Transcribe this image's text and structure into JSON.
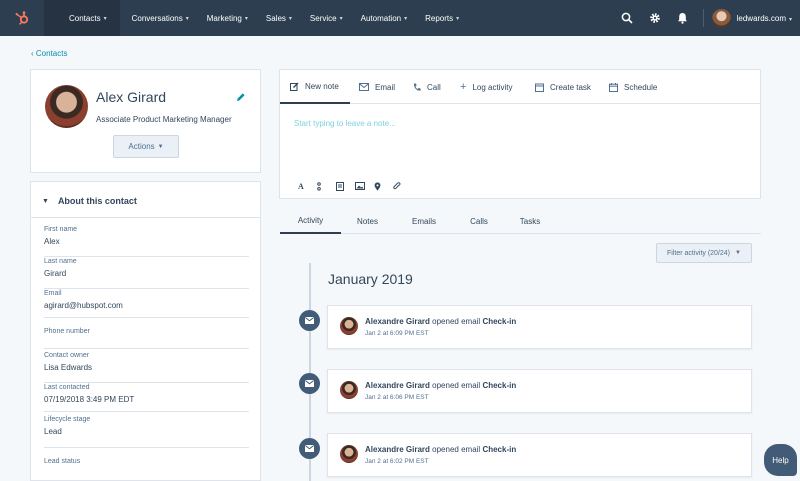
{
  "nav": {
    "items": [
      {
        "label": "Contacts",
        "active": true
      },
      {
        "label": "Conversations"
      },
      {
        "label": "Marketing"
      },
      {
        "label": "Sales"
      },
      {
        "label": "Service"
      },
      {
        "label": "Automation"
      },
      {
        "label": "Reports"
      }
    ],
    "account": "ledwards.com",
    "icons": [
      "search-icon",
      "gear-icon",
      "bell-icon"
    ]
  },
  "breadcrumb": "Contacts",
  "profile": {
    "name": "Alex Girard",
    "title": "Associate Product Marketing Manager",
    "actions_label": "Actions"
  },
  "about": {
    "header": "About this contact",
    "fields": [
      {
        "label": "First name",
        "value": "Alex"
      },
      {
        "label": "Last name",
        "value": "Girard"
      },
      {
        "label": "Email",
        "value": "agirard@hubspot.com"
      },
      {
        "label": "Phone number",
        "value": ""
      },
      {
        "label": "Contact owner",
        "value": "Lisa Edwards"
      },
      {
        "label": "Last contacted",
        "value": "07/19/2018 3:49 PM EDT"
      },
      {
        "label": "Lifecycle stage",
        "value": "Lead"
      },
      {
        "label": "Lead status",
        "value": ""
      }
    ]
  },
  "composer": {
    "tabs": [
      "New note",
      "Email",
      "Call",
      "Log activity",
      "Create task",
      "Schedule"
    ],
    "placeholder": "Start typing to leave a note..."
  },
  "tabs": [
    "Activity",
    "Notes",
    "Emails",
    "Calls",
    "Tasks"
  ],
  "filter_label": "Filter activity (20/24)",
  "timeline": {
    "month": "January 2019",
    "events": [
      {
        "actor": "Alexandre Girard",
        "action": "opened email",
        "subject": "Check-in",
        "time": "Jan 2 at 6:09 PM EST"
      },
      {
        "actor": "Alexandre Girard",
        "action": "opened email",
        "subject": "Check-in",
        "time": "Jan 2 at 6:06 PM EST"
      },
      {
        "actor": "Alexandre Girard",
        "action": "opened email",
        "subject": "Check-in",
        "time": "Jan 2 at 6:02 PM EST"
      }
    ]
  },
  "help_label": "Help",
  "colors": {
    "nav_bg": "#2d3e50",
    "accent": "#ff7a59",
    "link": "#0091ae",
    "timeline_dot": "#425b76"
  }
}
